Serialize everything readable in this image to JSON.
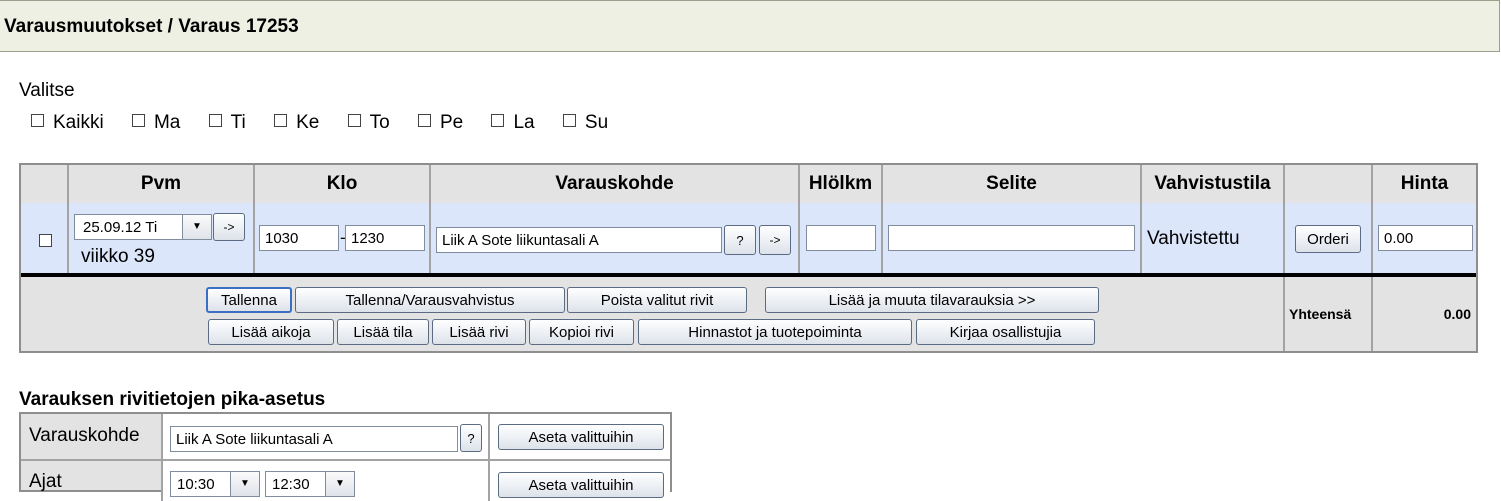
{
  "header": {
    "title": "Varausmuutokset / Varaus 17253"
  },
  "select_days": {
    "label": "Valitse",
    "days": [
      "Kaikki",
      "Ma",
      "Ti",
      "Ke",
      "To",
      "Pe",
      "La",
      "Su"
    ]
  },
  "table": {
    "columns": [
      "Pvm",
      "Klo",
      "Varauskohde",
      "Hlölkm",
      "Selite",
      "Vahvistustila",
      "",
      "Hinta"
    ],
    "row": {
      "date": "25.09.12 Ti",
      "week": "viikko 39",
      "date_arrow": "->",
      "time_start": "1030",
      "time_sep": "-",
      "time_end": "1230",
      "target": "Liik A Sote liikuntasali A",
      "help": "?",
      "target_arrow": "->",
      "persons": "",
      "description": "",
      "status": "Vahvistettu",
      "order_button": "Orderi",
      "price": "0.00"
    },
    "actions_row1": [
      "Tallenna",
      "Tallenna/Varausvahvistus",
      "Poista valitut rivit",
      "Lisää ja muuta tilavarauksia >>"
    ],
    "actions_row2": [
      "Lisää aikoja",
      "Lisää tila",
      "Lisää rivi",
      "Kopioi rivi",
      "Hinnastot ja tuotepoiminta",
      "Kirjaa osallistujia"
    ],
    "total_label": "Yhteensä",
    "total_value": "0.00"
  },
  "quick": {
    "title": "Varauksen rivitietojen pika-asetus",
    "row1_label": "Varauskohde",
    "row1_value": "Liik A Sote liikuntasali A",
    "row1_help": "?",
    "row1_button": "Aseta valittuihin",
    "row2_label": "Ajat",
    "row2_start": "10:30",
    "row2_end": "12:30",
    "row2_button": "Aseta valittuihin"
  }
}
